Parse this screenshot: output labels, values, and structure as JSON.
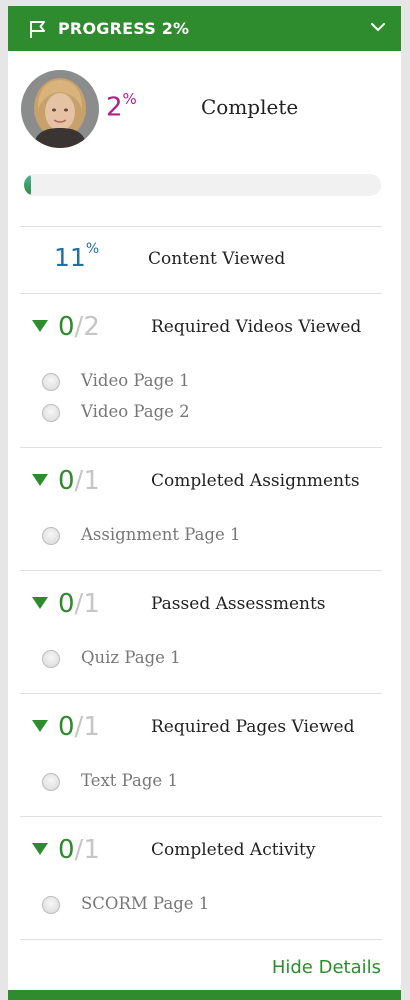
{
  "header": {
    "title": "PROGRESS 2%"
  },
  "summary": {
    "percent_value": "2",
    "percent_sign": "%",
    "label": "Complete",
    "progress_fraction": 0.02
  },
  "content_viewed": {
    "percent_value": "11",
    "percent_sign": "%",
    "label": "Content Viewed"
  },
  "sections": [
    {
      "done": "0",
      "total": "2",
      "label": "Required Videos Viewed",
      "items": [
        "Video Page 1",
        "Video Page 2"
      ]
    },
    {
      "done": "0",
      "total": "1",
      "label": "Completed Assignments",
      "items": [
        "Assignment Page 1"
      ]
    },
    {
      "done": "0",
      "total": "1",
      "label": "Passed Assessments",
      "items": [
        "Quiz Page 1"
      ]
    },
    {
      "done": "0",
      "total": "1",
      "label": "Required Pages Viewed",
      "items": [
        "Text Page 1"
      ]
    },
    {
      "done": "0",
      "total": "1",
      "label": "Completed Activity",
      "items": [
        "SCORM Page 1"
      ]
    }
  ],
  "footer": {
    "toggle_label": "Hide Details"
  },
  "colors": {
    "accent_green": "#2e8b2e",
    "summary_pink": "#b01f8c",
    "content_blue": "#1f6fa8"
  },
  "icons": {
    "header": "flag-icon",
    "collapse": "chevron-down-icon",
    "section": "caret-down-icon",
    "item": "radio-circle-icon"
  }
}
